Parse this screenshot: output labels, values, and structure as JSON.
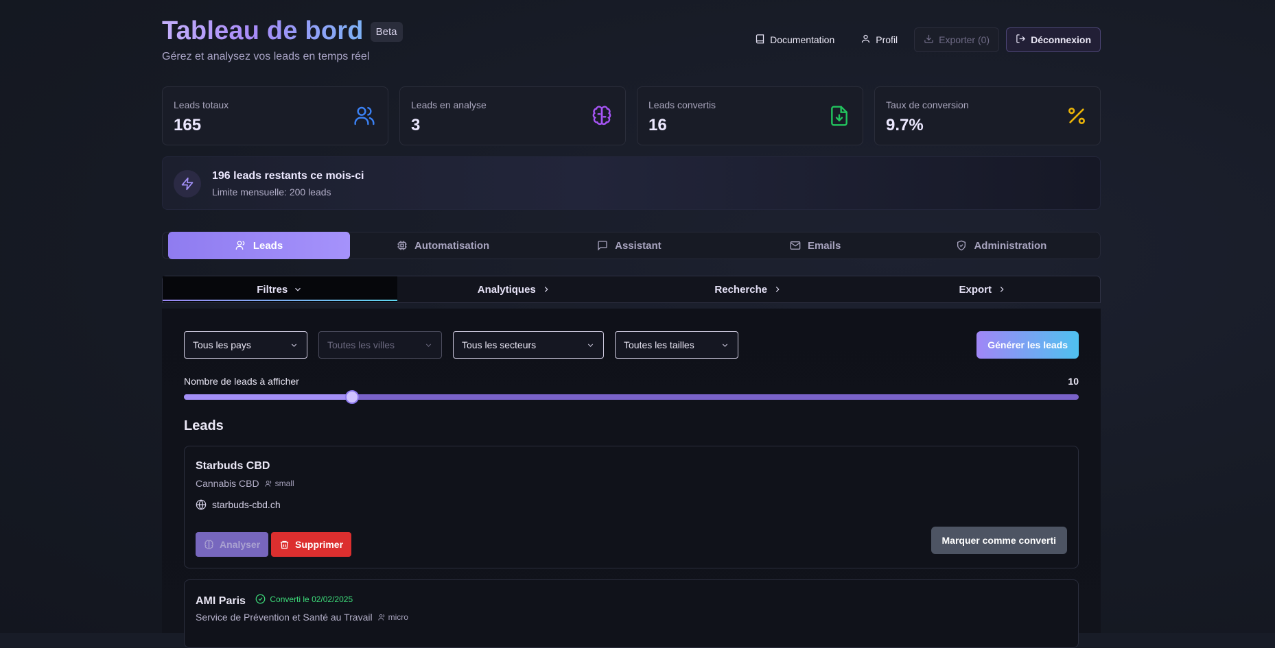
{
  "header": {
    "title": "Tableau de bord",
    "badge": "Beta",
    "subtitle": "Gérez et analysez vos leads en temps réel",
    "actions": {
      "documentation": "Documentation",
      "profile": "Profil",
      "export": "Exporter (0)",
      "logout": "Déconnexion"
    }
  },
  "stats": [
    {
      "label": "Leads totaux",
      "value": "165",
      "icon": "users-icon",
      "color": "#3b82f6"
    },
    {
      "label": "Leads en analyse",
      "value": "3",
      "icon": "brain-icon",
      "color": "#a855f7"
    },
    {
      "label": "Leads convertis",
      "value": "16",
      "icon": "file-download-icon",
      "color": "#22c55e"
    },
    {
      "label": "Taux de conversion",
      "value": "9.7%",
      "icon": "percent-icon",
      "color": "#eab308"
    }
  ],
  "quota": {
    "title": "196 leads restants ce mois-ci",
    "subtitle": "Limite mensuelle: 200 leads"
  },
  "tabs": [
    {
      "label": "Leads",
      "icon": "users-icon",
      "active": true
    },
    {
      "label": "Automatisation",
      "icon": "cpu-icon"
    },
    {
      "label": "Assistant",
      "icon": "message-icon"
    },
    {
      "label": "Emails",
      "icon": "mail-icon"
    },
    {
      "label": "Administration",
      "icon": "shield-icon"
    }
  ],
  "subtabs": [
    {
      "label": "Filtres",
      "active": true
    },
    {
      "label": "Analytiques"
    },
    {
      "label": "Recherche"
    },
    {
      "label": "Export"
    }
  ],
  "filters": {
    "country": "Tous les pays",
    "city": "Toutes les villes",
    "sector": "Tous les secteurs",
    "size": "Toutes les tailles",
    "generate": "Générer les leads"
  },
  "slider": {
    "label": "Nombre de leads à afficher",
    "value": "10",
    "fraction": 0.188
  },
  "leads_title": "Leads",
  "leads": [
    {
      "name": "Starbuds CBD",
      "sector": "Cannabis CBD",
      "size": "small",
      "website": "starbuds-cbd.ch",
      "analyse": "Analyser",
      "delete": "Supprimer",
      "convert": "Marquer comme converti"
    },
    {
      "name": "AMI Paris",
      "converted": "Converti le 02/02/2025",
      "sector": "Service de Prévention et Santé au Travail",
      "size": "micro"
    }
  ],
  "colors": {
    "accent": "#9b87f5",
    "danger": "#dc2f2f",
    "success": "#3ddc7a"
  }
}
